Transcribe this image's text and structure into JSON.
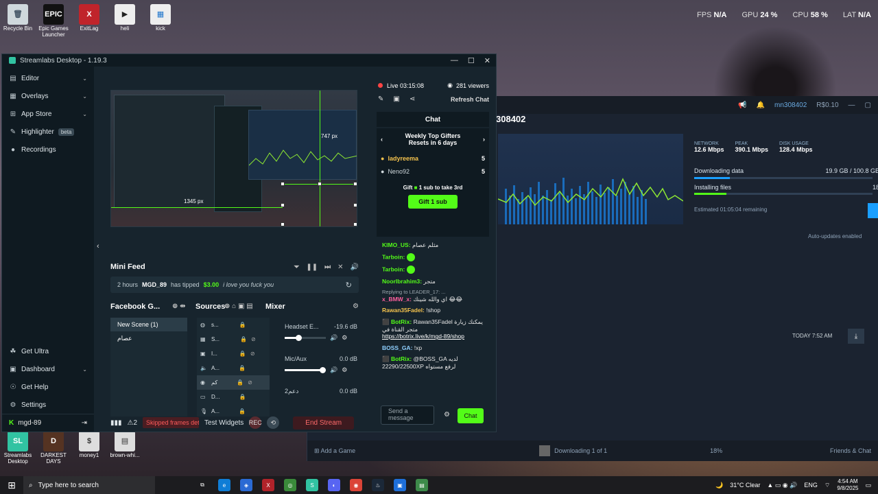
{
  "hud": {
    "fps_label": "FPS",
    "fps": "N/A",
    "gpu_label": "GPU",
    "gpu": "24 %",
    "cpu_label": "CPU",
    "cpu": "58 %",
    "lat_label": "LAT",
    "lat": "N/A"
  },
  "desktop_icons": [
    "Recycle Bin",
    "Epic Games Launcher",
    "ExitLag",
    "heli",
    "kick"
  ],
  "desktop_bottom_icons": [
    "Streamlabs Desktop",
    "DARKEST DAYS",
    "money1",
    "brown-whi..."
  ],
  "steam": {
    "user": "mn308402",
    "balance": "R$0.10",
    "title": "308402",
    "network_label": "NETWORK",
    "network": "12.6 Mbps",
    "peak_label": "PEAK",
    "peak": "390.1 Mbps",
    "disk_label": "DISK USAGE",
    "disk": "128.4 Mbps",
    "downloading_label": "Downloading data",
    "downloading_value": "19.9 GB / 100.8 GB",
    "installing_label": "Installing files",
    "installing_value": "18",
    "remaining": "Estimated 01:05:04 remaining",
    "auto_updates": "Auto-updates enabled",
    "today": "TODAY 7:52 AM",
    "add_game": "Add a Game",
    "dl_status": "Downloading 1 of 1",
    "dl_percent": "18%",
    "friends": "Friends & Chat"
  },
  "streamlabs": {
    "title": "Streamlabs Desktop - 1.19.3",
    "nav": [
      {
        "label": "Editor",
        "chevron": true
      },
      {
        "label": "Overlays",
        "chevron": true
      },
      {
        "label": "App Store",
        "chevron": true
      },
      {
        "label": "Highlighter",
        "badge": "beta"
      },
      {
        "label": "Recordings"
      }
    ],
    "bottom_nav": [
      "Get Ultra",
      "Dashboard",
      "Get Help",
      "Settings"
    ],
    "account": "mgd-89",
    "preview": {
      "px_top": "747 px",
      "px_bottom": "1345 px"
    },
    "mini_feed": {
      "title": "Mini Feed",
      "time": "2 hours",
      "user": "MGD_89",
      "action": "has tipped",
      "amount": "$3.00",
      "message": "i love you fuck you"
    },
    "panels": {
      "scenes_title": "Facebook G...",
      "sources_title": "Sources",
      "mixer_title": "Mixer"
    },
    "scenes": [
      "New Scene (1)",
      "عصام"
    ],
    "sources": [
      "s...",
      "S...",
      "I...",
      "A...",
      "كم",
      "D...",
      "A..."
    ],
    "mixer": [
      {
        "name": "Headset E...",
        "db": "-19.6 dB",
        "level": 0.3
      },
      {
        "name": "Mic/Aux",
        "db": "0.0 dB",
        "level": 0.9
      },
      {
        "name": "دعم2",
        "db": "0.0 dB"
      }
    ],
    "status": {
      "alerts": "2",
      "skipped": "Skipped frames det",
      "test_widgets": "Test Widgets",
      "end_stream": "End Stream"
    }
  },
  "chat": {
    "live": "Live 03:15:08",
    "viewers": "281 viewers",
    "refresh": "Refresh Chat",
    "title": "Chat",
    "gifters_title": "Weekly Top Gifters",
    "gifters_sub": "Resets in 6 days",
    "gifters": [
      {
        "name": "ladyreema",
        "count": "5"
      },
      {
        "name": "Neno92",
        "count": "5"
      }
    ],
    "gift_prompt_a": "Gift",
    "gift_prompt_b": "1 sub to take 3rd",
    "gift_button": "Gift 1 sub",
    "messages": [
      {
        "name": "KIMO_US:",
        "color": "#53fc18",
        "text": "مثلم عصام"
      },
      {
        "name": "Tarboin:",
        "color": "#53fc18",
        "text": "",
        "emote": true
      },
      {
        "name": "Tarboin:",
        "color": "#53fc18",
        "text": "",
        "emote": true
      },
      {
        "name": "NoorIbrahim3:",
        "color": "#53fc18",
        "text": "متجر"
      },
      {
        "reply": "Replying to LEADER_17: ...",
        "name": "x_BMW_x:",
        "color": "#ff5f9e",
        "text": "اي والله شينك 😂😂"
      },
      {
        "name": "Rawan35Fadel:",
        "color": "#f4c24d",
        "text": "!shop"
      },
      {
        "name": "BotRix:",
        "color": "#53fc18",
        "text": "Rawan35Fadel يمكنك زيارة متجر القناة في",
        "link": "https://botrix.live/k/mgd-89/shop"
      },
      {
        "name": "BOSS_GA:",
        "color": "#8fd0ff",
        "text": "!xp"
      },
      {
        "name": "BotRix:",
        "color": "#53fc18",
        "text": "@BOSS_GA لديه 22290/22500XP لرفع مستواه"
      }
    ],
    "input_placeholder": "Send a message",
    "send_button": "Chat"
  },
  "taskbar": {
    "search_placeholder": "Type here to search",
    "weather": "31°C  Clear",
    "lang": "ENG",
    "time": "4:54 AM",
    "date": "9/8/2025"
  }
}
